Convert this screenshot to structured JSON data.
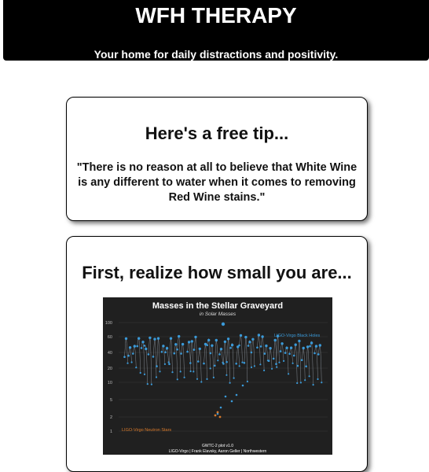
{
  "header": {
    "title": "WFH THERAPY",
    "tagline": "Your home for daily distractions and positivity."
  },
  "tip_card": {
    "heading": "Here's a free tip...",
    "quote": "\"There is no reason at all to believe that White Wine is any different to water when it comes to removing Red Wine stains.\""
  },
  "space_card": {
    "heading": "First, realize how small you are...",
    "image": {
      "title": "Masses in the Stellar Graveyard",
      "subtitle": "in Solar Masses",
      "y_ticks": [
        "100",
        "60",
        "40",
        "20",
        "10",
        "5",
        "2",
        "1"
      ],
      "legend_black_holes": "LIGO-Virgo Black Holes",
      "legend_neutron_stars": "LIGO-Virgo Neutron Stars",
      "footer_line1": "GWTC-2 plot v1.0",
      "footer_line2": "LIGO-Virgo | Frank Elavsky, Aaron Geller | Northwestern",
      "colors": {
        "background": "#202020",
        "black_hole": "#3a9ad9",
        "neutron_star": "#d97a2b",
        "text": "#ffffff"
      }
    }
  }
}
